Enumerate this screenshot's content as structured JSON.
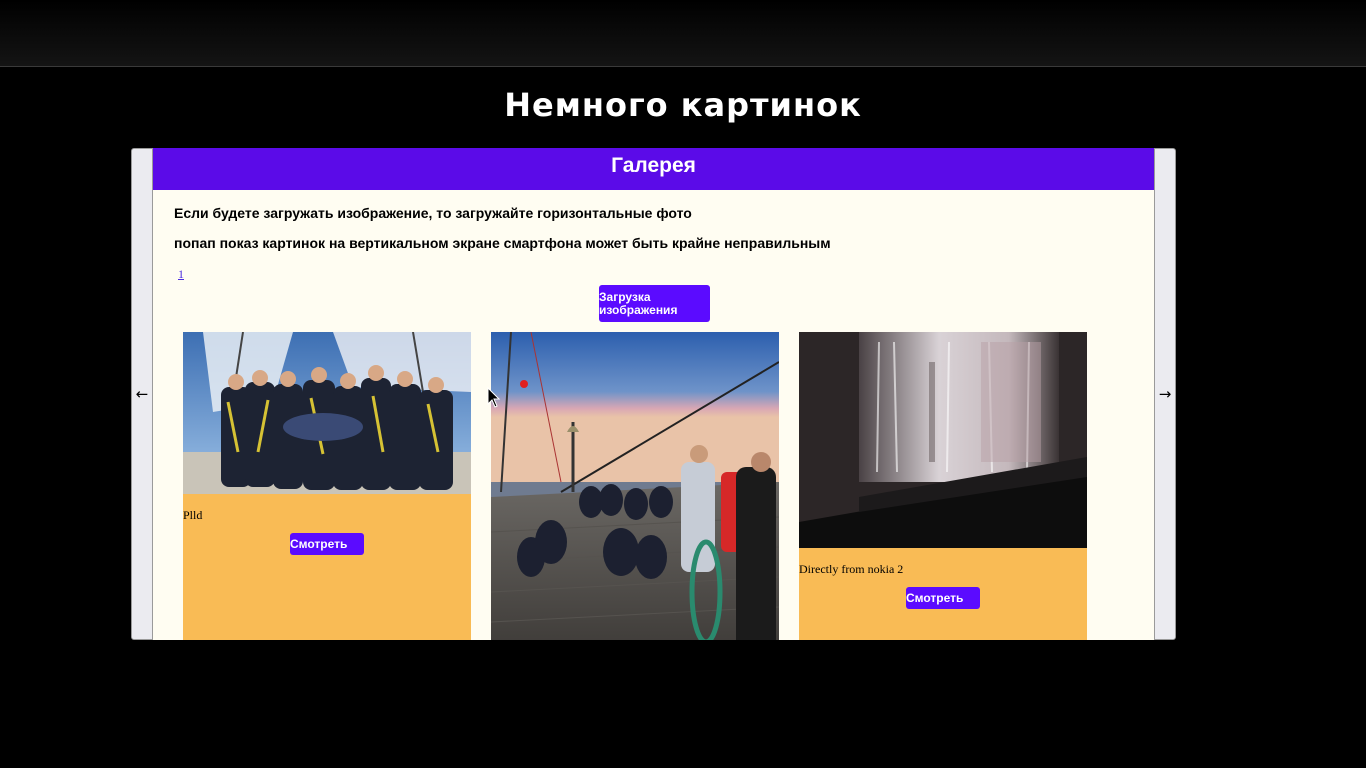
{
  "page": {
    "title": "Немного картинок"
  },
  "gallery": {
    "header": "Галерея",
    "note_horizontal": "Если будете загружать изображение, то загружайте горизонтальные фото",
    "note_vertical": "попап показ картинок на вертикальном экране смартфона может быть крайне неправильным",
    "page_link": "1",
    "upload_label": "Загрузка изображения",
    "prev_label": "←",
    "next_label": "→",
    "cards": [
      {
        "caption": "Plld",
        "view_label": "Смотреть"
      },
      {
        "caption": "",
        "view_label": ""
      },
      {
        "caption": "Directly from nokia 2",
        "view_label": "Смотреть"
      }
    ]
  },
  "colors": {
    "accent": "#5b0bff",
    "header": "#5b0be8",
    "card": "#f9bb55",
    "panel": "#fffdf2"
  }
}
